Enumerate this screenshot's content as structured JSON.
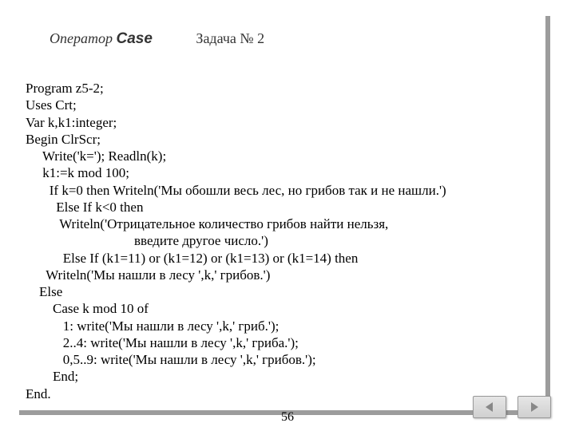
{
  "header": {
    "op": "Оператор ",
    "case": "Case",
    "task": "Задача № 2"
  },
  "code": "Program z5-2;\nUses Crt;\nVar k,k1:integer;\nBegin ClrScr;\n     Write('k='); Readln(k);\n     k1:=k mod 100;\n       If k=0 then Writeln('Мы обошли весь лес, но грибов так и не нашли.')\n         Else If k<0 then\n          Writeln('Отрицательное количество грибов найти нельзя,\n                                введите другое число.')\n           Else If (k1=11) or (k1=12) or (k1=13) or (k1=14) then\n      Writeln('Мы нашли в лесу ',k,' грибов.')\n    Else\n        Case k mod 10 of\n           1: write('Мы нашли в лесу ',k,' гриб.');\n           2..4: write('Мы нашли в лесу ',k,' гриба.');\n           0,5..9: write('Мы нашли в лесу ',k,' грибов.');\n        End;\nEnd.",
  "pagenum": "56",
  "icons": {
    "prev": "prev-icon",
    "next": "next-icon"
  }
}
